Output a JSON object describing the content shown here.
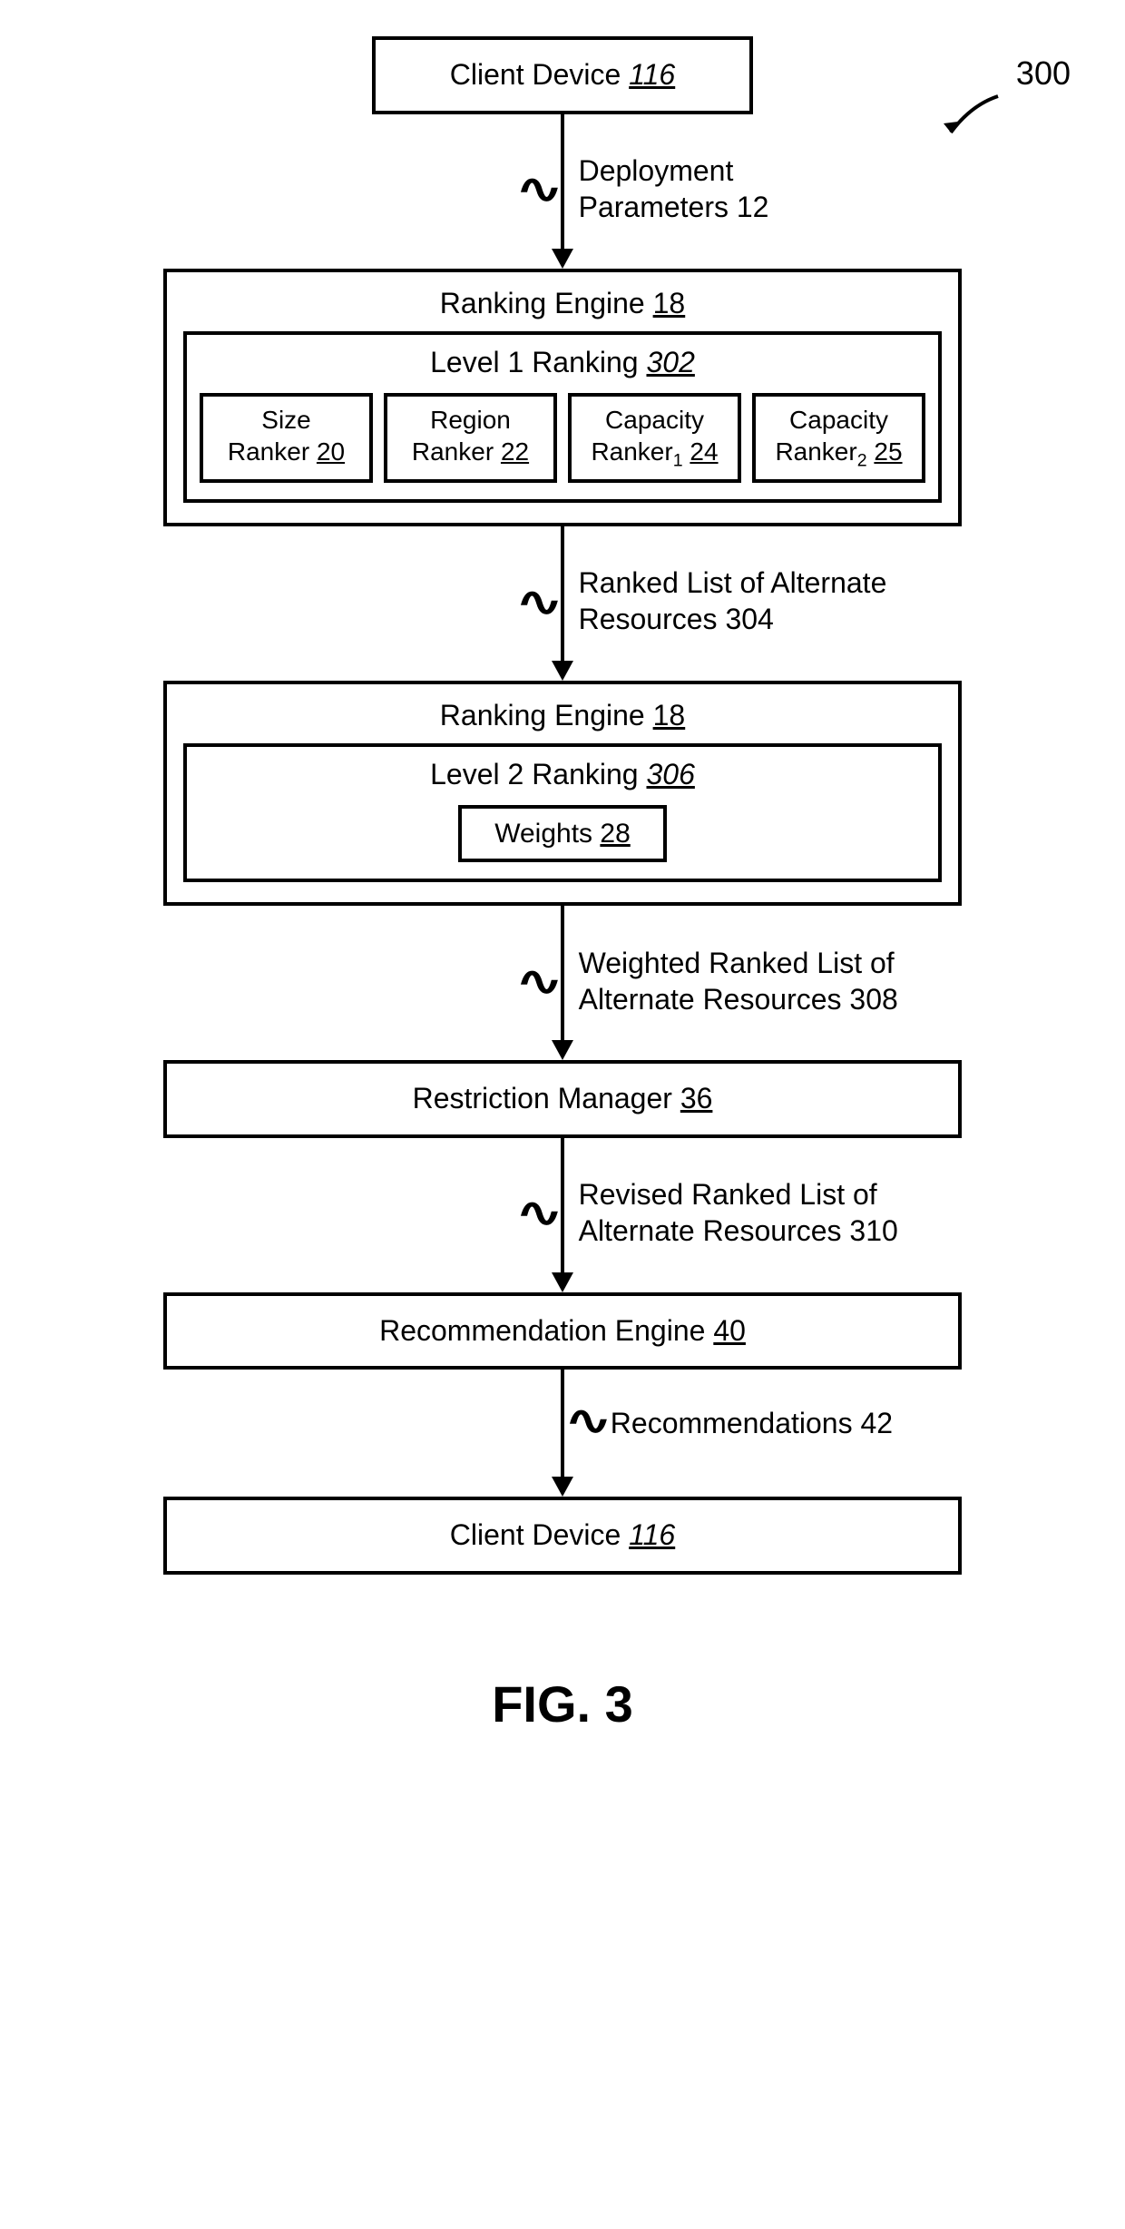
{
  "figure": {
    "label": "FIG. 3",
    "callout": "300"
  },
  "boxes": {
    "client_top": {
      "label": "Client Device",
      "ref": "116"
    },
    "client_bottom": {
      "label": "Client Device",
      "ref": "116"
    },
    "restriction": {
      "label": "Restriction Manager",
      "ref": "36"
    },
    "recommendation": {
      "label": "Recommendation Engine",
      "ref": "40"
    }
  },
  "ranking1": {
    "title": "Ranking Engine",
    "title_ref": "18",
    "level_title": "Level 1 Ranking",
    "level_ref": "302",
    "rankers": [
      {
        "line1": "Size",
        "line2": "Ranker",
        "ref": "20",
        "sub": ""
      },
      {
        "line1": "Region",
        "line2": "Ranker",
        "ref": "22",
        "sub": ""
      },
      {
        "line1": "Capacity",
        "line2": "Ranker",
        "ref": "24",
        "sub": "1"
      },
      {
        "line1": "Capacity",
        "line2": "Ranker",
        "ref": "25",
        "sub": "2"
      }
    ]
  },
  "ranking2": {
    "title": "Ranking Engine",
    "title_ref": "18",
    "level_title": "Level 2 Ranking",
    "level_ref": "306",
    "weights_label": "Weights",
    "weights_ref": "28"
  },
  "arrows": {
    "a1": {
      "line1": "Deployment",
      "line2": "Parameters 12"
    },
    "a2": {
      "line1": "Ranked List of Alternate",
      "line2": "Resources 304"
    },
    "a3": {
      "line1": "Weighted Ranked List of",
      "line2": "Alternate Resources 308"
    },
    "a4": {
      "line1": "Revised Ranked List of",
      "line2": "Alternate Resources 310"
    },
    "a5": {
      "line1": "Recommendations 42",
      "line2": ""
    }
  }
}
